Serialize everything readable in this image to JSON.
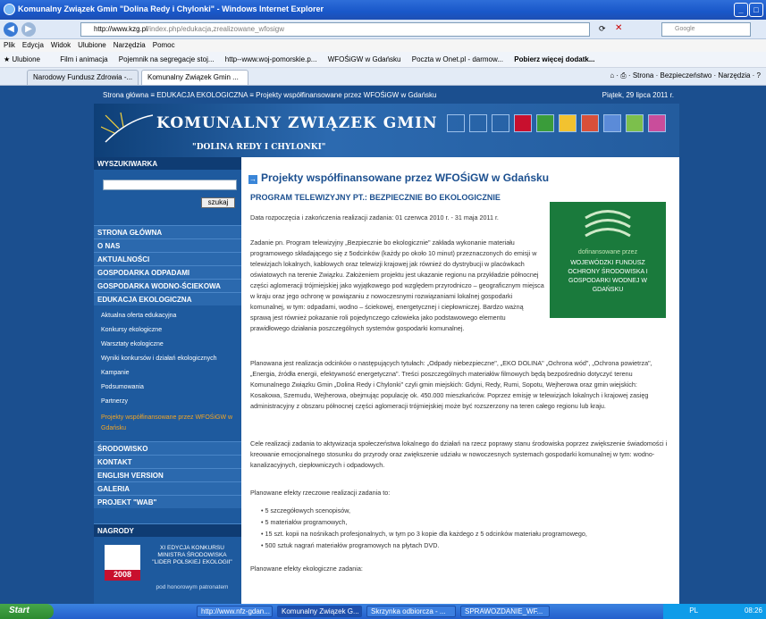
{
  "window": {
    "title": "Komunalny Związek Gmin \"Dolina Redy i Chylonki\" - Windows Internet Explorer"
  },
  "address": {
    "url_host": "http://www.kzg.pl",
    "url_path": "/index.php/edukacja,zrealizowane_wfosigw",
    "search_placeholder": "Google"
  },
  "menu": [
    "Plik",
    "Edycja",
    "Widok",
    "Ulubione",
    "Narzędzia",
    "Pomoc"
  ],
  "favorites": {
    "label": "Ulubione",
    "items": [
      "Film i animacja",
      "Pojemnik na segregacje stoj...",
      "http--www.woj-pomorskie.p...",
      "WFOŚiGW w Gdańsku",
      "Poczta w Onet.pl - darmow...",
      "Pobierz więcej dodatk..."
    ]
  },
  "tabs": [
    "Narodowy Fundusz Zdrowia -...",
    "Komunalny Związek Gmin ..."
  ],
  "commandbar": {
    "page": "Strona",
    "safety": "Bezpieczeństwo",
    "tools": "Narzędzia"
  },
  "page": {
    "breadcrumb": "Strona główna  ≡ EDUKACJA EKOLOGICZNA  ≡ Projekty współfinansowane przez WFOŚiGW w Gdańsku",
    "date": "Piątek, 29 lipca 2011 r.",
    "logo_title": "KOMUNALNY ZWIĄZEK GMIN",
    "logo_sub": "\"DOLINA REDY I CHYLONKI\"",
    "sidebar": {
      "search_heading": "WYSZUKIWARKA",
      "search_button": "szukaj",
      "items": [
        "STRONA GŁÓWNA",
        "O NAS",
        "AKTUALNOŚCI",
        "GOSPODARKA ODPADAMI",
        "GOSPODARKA WODNO-ŚCIEKOWA",
        "EDUKACJA EKOLOGICZNA"
      ],
      "subitems": [
        "Aktualna oferta edukacyjna",
        "Konkursy ekologiczne",
        "Warsztaty ekologiczne",
        "Wyniki konkursów i działań ekologicznych",
        "Kampanie",
        "Podsumowania",
        "Partnerzy",
        "Projekty współfinansowane przez WFOŚiGW w Gdańsku"
      ],
      "items2": [
        "ŚRODOWISKO",
        "KONTAKT",
        "ENGLISH VERSION",
        "GALERIA",
        "PROJEKT \"WAB\""
      ],
      "awards_heading": "NAGRODY",
      "award_text": "XI EDYCJA KONKURSU MINISTRA ŚRODOWISKA \"LIDER POLSKIEJ EKOLOGII\"",
      "award_year": "2008",
      "award_patron": "pod honorowym patronatem"
    },
    "content": {
      "h1": "Projekty współfinansowane przez WFOŚiGW w Gdańsku",
      "h2": "PROGRAM TELEWIZYJNY PT.: BEZPIECZNIE BO EKOLOGICZNIE",
      "dates": "Data rozpoczęcia i zakończenia realizacji zadania: 01 czerwca 2010 r. - 31 maja 2011 r.",
      "p1": "Zadanie pn. Program telewizyjny „Bezpiecznie bo ekologicznie\" zakłada wykonanie materiału programowego składającego się z 5odcinków (każdy po około 10 minut) przeznaczonych do emisji w telewizjach lokalnych, kablowych oraz telewizji krajowej jak również do dystrybucji w placówkach oświatowych na terenie Związku. Założeniem projektu jest ukazanie regionu na przykładzie północnej części aglomeracji trójmiejskiej jako wyjątkowego pod względem przyrodniczo – geograficznym miejsca w kraju oraz jego ochronę w powiązaniu z nowoczesnymi rozwiązaniami lokalnej gospodarki komunalnej, w tym: odpadami, wodno – ściekowej, energetycznej i ciepłowniczej. Bardzo ważną sprawą jest również pokazanie roli pojedynczego człowieka jako podstawowego elementu prawidłowego działania poszczególnych systemów gospodarki komunalnej.",
      "p2": "Planowana jest realizacja odcinków o następujących tytułach: „Odpady niebezpieczne\", „EKO DOLINA\" „Ochrona wód\", „Ochrona powietrza\", „Energia, źródła energii, efektywność energetyczna\". Treści poszczególnych materiałów filmowych będą bezpośrednio dotyczyć terenu Komunalnego Związku Gmin „Dolina Redy i Chylonki\" czyli gmin miejskich: Gdyni, Redy, Rumi, Sopotu, Wejherowa oraz gmin wiejskich: Kosakowa, Szemudu, Wejherowa, obejmując populację ok. 450.000 mieszkańców. Poprzez emisję w telewizjach lokalnych i krajowej zasięg administracyjny z obszaru północnej części aglomeracji trójmiejskiej może być rozszerzony na teren całego regionu lub kraju.",
      "p3": "Cele realizacji zadania to aktywizacja społeczeństwa lokalnego do działań na rzecz poprawy stanu środowiska poprzez zwiększenie świadomości i kreowanie emocjonalnego stosunku do przyrody oraz zwiększenie udziału w nowoczesnych systemach gospodarki komunalnej w tym: wodno-kanalizacyjnych, ciepłowniczych i odpadowych.",
      "p4": "Planowane efekty rzeczowe realizacji zadania to:",
      "bullets": [
        "5 szczegółowych scenopisów,",
        "5 materiałów programowych,",
        "15 szt. kopii na nośnikach profesjonalnych, w tym po 3 kopie dla każdego z 5 odcinków materiału programowego,",
        "500 sztuk nagrań materiałów programowych na płytach DVD."
      ],
      "p5": "Planowane efekty ekologiczne zadania:",
      "badge_top": "dofinansowane przez",
      "badge": "WOJEWÓDZKI FUNDUSZ OCHRONY ŚRODOWISKA I GOSPODARKI WODNEJ W GDAŃSKU"
    }
  },
  "taskbar": {
    "start": "Start",
    "tasks": [
      "http://www.nfz-gdan...",
      "Komunalny Związek G...",
      "Skrzynka odbiorcza - ...",
      "SPRAWOZDANIE_WF..."
    ],
    "lang": "PL",
    "time": "08:26"
  }
}
